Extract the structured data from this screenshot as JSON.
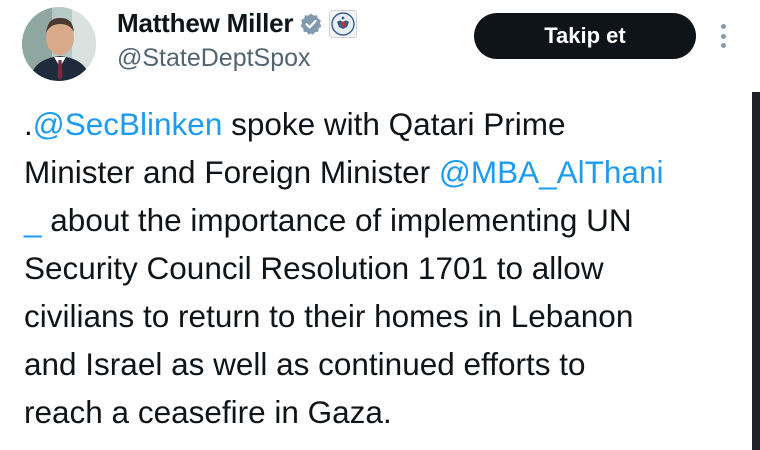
{
  "author": {
    "display_name": "Matthew Miller",
    "handle": "@StateDeptSpox",
    "verified_badge_icon": "verified-badge-icon",
    "affiliation_icon": "state-department-seal-icon",
    "avatar_icon": "profile-photo-avatar"
  },
  "follow_button": {
    "label": "Takip et"
  },
  "more_menu_icon": "more-vertical-icon",
  "tweet": {
    "lines": [
      [
        {
          "text": ".",
          "type": "text"
        },
        {
          "text": "@SecBlinken",
          "type": "mention"
        },
        {
          "text": " spoke with Qatari Prime",
          "type": "text"
        }
      ],
      [
        {
          "text": "Minister and Foreign Minister ",
          "type": "text"
        },
        {
          "text": "@MBA_AlThani",
          "type": "mention"
        }
      ],
      [
        {
          "text": "_",
          "type": "mention"
        },
        {
          "text": " about the importance of implementing UN",
          "type": "text"
        }
      ],
      [
        {
          "text": "Security Council Resolution 1701 to allow",
          "type": "text"
        }
      ],
      [
        {
          "text": "civilians to return to their homes in Lebanon",
          "type": "text"
        }
      ],
      [
        {
          "text": "and Israel as well as continued efforts to",
          "type": "text"
        }
      ],
      [
        {
          "text": "reach a ceasefire in Gaza.",
          "type": "text"
        }
      ]
    ]
  },
  "colors": {
    "mention": "#1d9bf0",
    "text": "#0f1419",
    "secondary_text": "#536471",
    "follow_button_bg": "#0f1419",
    "verified_badge": "#829aab"
  }
}
